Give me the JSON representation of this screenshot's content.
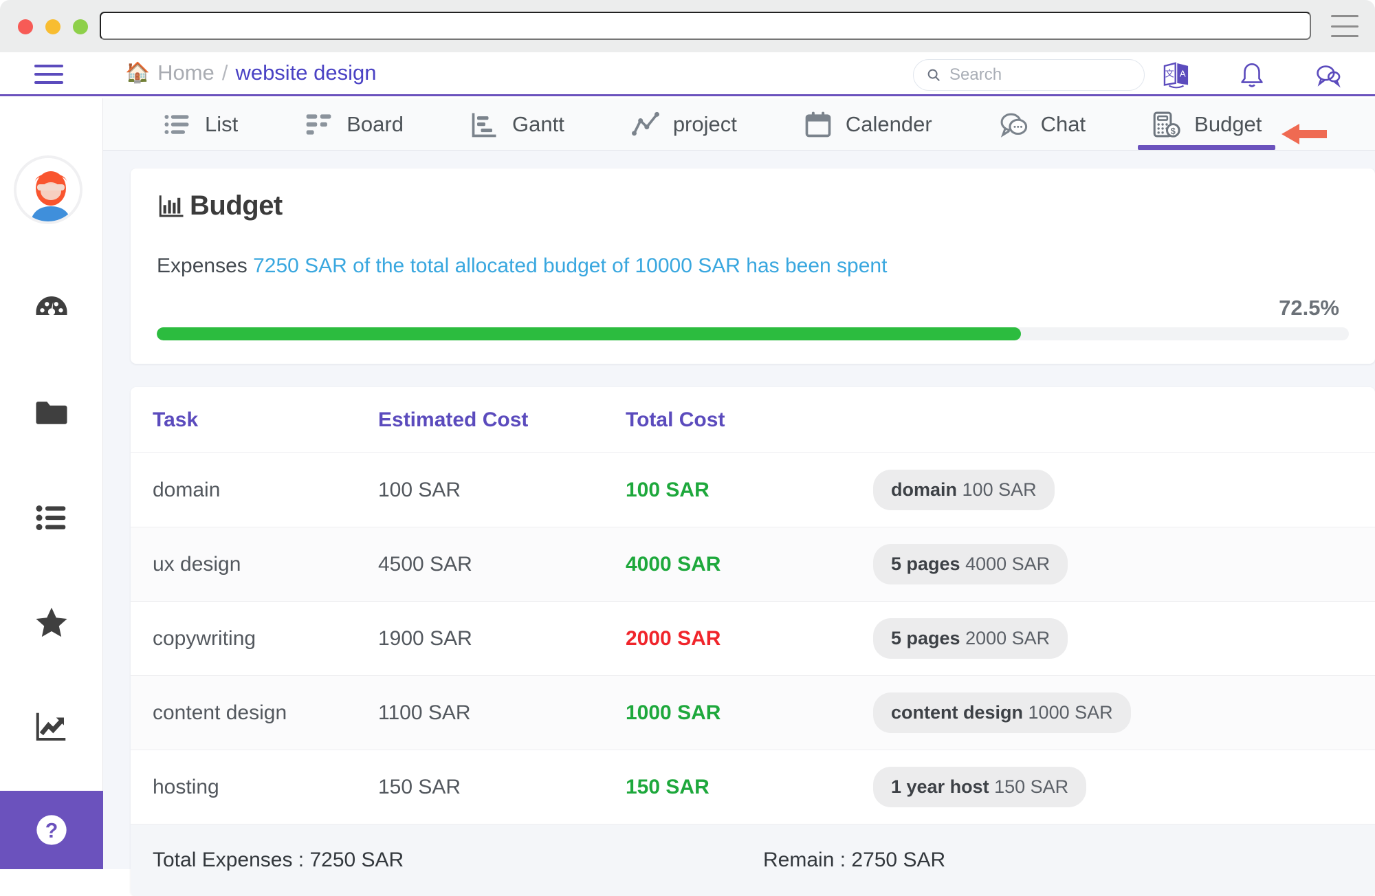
{
  "browser": {
    "url_value": "",
    "url_placeholder": "",
    "menu_icon": "hamburger-icon",
    "traffic_lights": [
      "close",
      "minimize",
      "maximize"
    ]
  },
  "header": {
    "menu_toggle_icon": "hamburger-icon",
    "breadcrumb": {
      "home_icon": "home-icon",
      "home_label": "Home",
      "separator": "/",
      "current_label": "website design"
    },
    "search": {
      "placeholder": "Search",
      "value": "",
      "icon": "search-icon"
    },
    "icons": [
      {
        "name": "translate-icon",
        "color": "#5b4bbd"
      },
      {
        "name": "bell-icon",
        "color": "#5b4bbd"
      },
      {
        "name": "chat-bubbles-icon",
        "color": "#5b4bbd"
      }
    ]
  },
  "sidebar": {
    "avatar": "user-avatar",
    "items": [
      {
        "name": "dashboard",
        "icon": "speedometer-icon"
      },
      {
        "name": "files",
        "icon": "folder-icon"
      },
      {
        "name": "tasks",
        "icon": "bulleted-list-icon"
      },
      {
        "name": "favorites",
        "icon": "star-icon"
      },
      {
        "name": "reports",
        "icon": "growth-chart-icon"
      }
    ],
    "help": {
      "name": "help",
      "icon": "question-mark-icon"
    }
  },
  "tabs": [
    {
      "label": "List",
      "icon": "list-icon",
      "active": false
    },
    {
      "label": "Board",
      "icon": "board-icon",
      "active": false
    },
    {
      "label": "Gantt",
      "icon": "gantt-icon",
      "active": false
    },
    {
      "label": "project",
      "icon": "line-chart-icon",
      "active": false
    },
    {
      "label": "Calender",
      "icon": "calendar-icon",
      "active": false
    },
    {
      "label": "Chat",
      "icon": "chat-icon",
      "active": false
    },
    {
      "label": "Budget",
      "icon": "calculator-dollar-icon",
      "active": true
    }
  ],
  "annotation": {
    "arrow": "left-pointing-arrow",
    "color": "#ef6a52",
    "points_to": "Budget"
  },
  "budget": {
    "title": "Budget",
    "title_icon": "bar-chart-icon",
    "summary": {
      "prefix": "Expenses ",
      "highlight": "7250 SAR of the total allocated budget of 10000 SAR has been spent",
      "spent": "7250 SAR",
      "allocated": "10000 SAR"
    },
    "progress": {
      "percent_label": "72.5%",
      "percent_value": 72.5,
      "fill_color": "#2cbc3f",
      "track_color": "#f2f3f5"
    }
  },
  "table": {
    "columns": [
      "Task",
      "Estimated Cost",
      "Total Cost"
    ],
    "rows": [
      {
        "task": "domain",
        "estimated": "100 SAR",
        "total": "100 SAR",
        "total_state": "green",
        "tag_bold": "domain",
        "tag_rest": "100 SAR"
      },
      {
        "task": "ux design",
        "estimated": "4500 SAR",
        "total": "4000 SAR",
        "total_state": "green",
        "tag_bold": "5 pages",
        "tag_rest": "4000 SAR"
      },
      {
        "task": "copywriting",
        "estimated": "1900 SAR",
        "total": "2000 SAR",
        "total_state": "red",
        "tag_bold": "5 pages",
        "tag_rest": "2000 SAR"
      },
      {
        "task": "content design",
        "estimated": "1100 SAR",
        "total": "1000 SAR",
        "total_state": "green",
        "tag_bold": "content design",
        "tag_rest": "1000 SAR"
      },
      {
        "task": "hosting",
        "estimated": "150 SAR",
        "total": "150 SAR",
        "total_state": "green",
        "tag_bold": "1 year host",
        "tag_rest": "150 SAR"
      }
    ],
    "footer": {
      "total_expenses": "Total Expenses : 7250 SAR",
      "remain": "Remain : 2750 SAR"
    }
  }
}
